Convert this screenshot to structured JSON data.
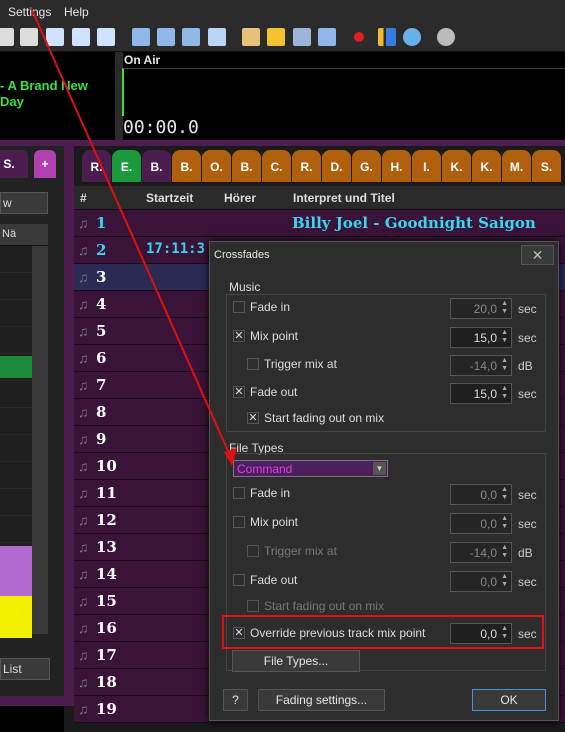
{
  "menu": {
    "settings": "Settings",
    "help": "Help"
  },
  "nowplaying": {
    "left_line1": "- A Brand New",
    "left_line2": "Day",
    "onair": "On Air",
    "timer": "00:00.0"
  },
  "tabs": [
    "R.",
    "E.",
    "B.",
    "B.",
    "O.",
    "B.",
    "C.",
    "R.",
    "D.",
    "G.",
    "H.",
    "I.",
    "K.",
    "K.",
    "M.",
    "S."
  ],
  "left": {
    "tab1": "S.",
    "tab2": "+",
    "combo": "w",
    "col": "Nä",
    "list": "List"
  },
  "grid": {
    "headers": [
      "#",
      "Startzeit",
      "Hörer",
      "Interpret und Titel"
    ],
    "row1_title": "Billy Joel - Goodnight Saigon",
    "row2_time": "17:11:3",
    "rows": [
      "1",
      "2",
      "3",
      "4",
      "5",
      "6",
      "7",
      "8",
      "9",
      "10",
      "11",
      "12",
      "13",
      "14",
      "15",
      "16",
      "17",
      "18",
      "19"
    ]
  },
  "dialog": {
    "title": "Crossfades",
    "close": "✕",
    "music": {
      "label": "Music",
      "fade_in": "Fade in",
      "fade_in_val": "20,0",
      "mix_point": "Mix point",
      "mix_point_val": "15,0",
      "trigger": "Trigger mix at",
      "trigger_val": "-14,0",
      "fade_out": "Fade out",
      "fade_out_val": "15,0",
      "start_fading": "Start fading out on mix"
    },
    "filetypes": {
      "label": "File Types",
      "selected": "Command",
      "fade_in": "Fade in",
      "fade_in_val": "0,0",
      "mix_point": "Mix point",
      "mix_point_val": "0,0",
      "trigger": "Trigger mix at",
      "trigger_val": "-14,0",
      "fade_out": "Fade out",
      "fade_out_val": "0,0",
      "start_fading": "Start fading out on mix",
      "override": "Override previous track mix point",
      "override_val": "0,0",
      "file_types_btn": "File Types..."
    },
    "units": {
      "sec": "sec",
      "db": "dB"
    },
    "help_btn": "?",
    "fading_btn": "Fading settings...",
    "ok_btn": "OK"
  },
  "colors": {
    "accent_green": "#3ee03e",
    "row_bg": "#3a1438",
    "highlight_red": "#e01010",
    "title_cyan": "#39d6f0"
  }
}
